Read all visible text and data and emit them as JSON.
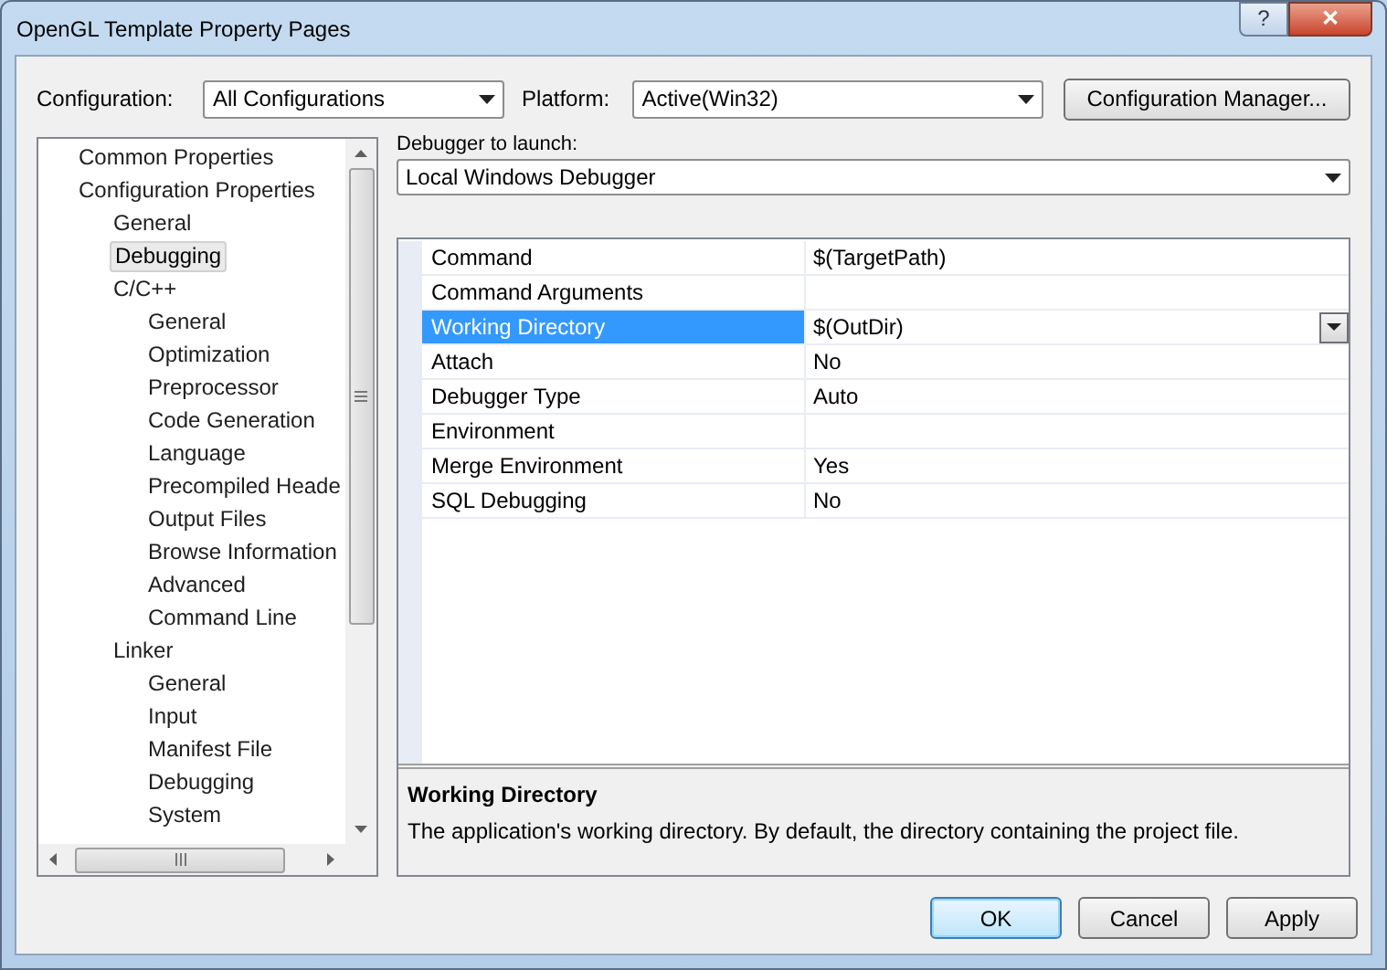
{
  "window": {
    "title": "OpenGL Template Property Pages",
    "buttons": [
      "?",
      "✕"
    ]
  },
  "configuration": {
    "label": "Configuration:",
    "value": "All Configurations"
  },
  "platform": {
    "label": "Platform:",
    "value": "Active(Win32)"
  },
  "configuration_manager": "Configuration Manager...",
  "tree": [
    {
      "label": "Common Properties",
      "selected": false
    },
    {
      "label": "Configuration Properties",
      "selected": false,
      "children": [
        {
          "label": "General",
          "selected": false
        },
        {
          "label": "Debugging",
          "selected": true
        },
        {
          "label": "C/C++",
          "selected": false,
          "children": [
            {
              "label": "General",
              "selected": false
            },
            {
              "label": "Optimization",
              "selected": false
            },
            {
              "label": "Preprocessor",
              "selected": false
            },
            {
              "label": "Code Generation",
              "selected": false
            },
            {
              "label": "Language",
              "selected": false
            },
            {
              "label": "Precompiled Heade",
              "selected": false
            },
            {
              "label": "Output Files",
              "selected": false
            },
            {
              "label": "Browse Information",
              "selected": false
            },
            {
              "label": "Advanced",
              "selected": false
            },
            {
              "label": "Command Line",
              "selected": false
            }
          ]
        },
        {
          "label": "Linker",
          "selected": false,
          "children": [
            {
              "label": "General",
              "selected": false
            },
            {
              "label": "Input",
              "selected": false
            },
            {
              "label": "Manifest File",
              "selected": false
            },
            {
              "label": "Debugging",
              "selected": false
            },
            {
              "label": "System",
              "selected": false
            }
          ]
        }
      ]
    }
  ],
  "debugger": {
    "label": "Debugger to launch:",
    "value": "Local Windows Debugger"
  },
  "properties": [
    {
      "name": "Command",
      "value": "$(TargetPath)",
      "selected": false
    },
    {
      "name": "Command Arguments",
      "selected": false
    },
    {
      "name": "Working Directory",
      "value": "$(OutDir)",
      "selected": true
    },
    {
      "name": "Attach",
      "value": "No",
      "selected": false
    },
    {
      "name": "Debugger Type",
      "value": "Auto",
      "selected": false
    },
    {
      "name": "Environment",
      "selected": false
    },
    {
      "name": "Merge Environment",
      "value": "Yes",
      "selected": false
    },
    {
      "name": "SQL Debugging",
      "value": "No",
      "selected": false
    }
  ],
  "description": {
    "title": "Working Directory",
    "text": "The application's working directory.  By default, the directory containing the project file."
  },
  "buttons": [
    {
      "label": "OK",
      "default": true
    },
    {
      "label": "Cancel",
      "default": false
    },
    {
      "label": "Apply",
      "default": false
    }
  ]
}
